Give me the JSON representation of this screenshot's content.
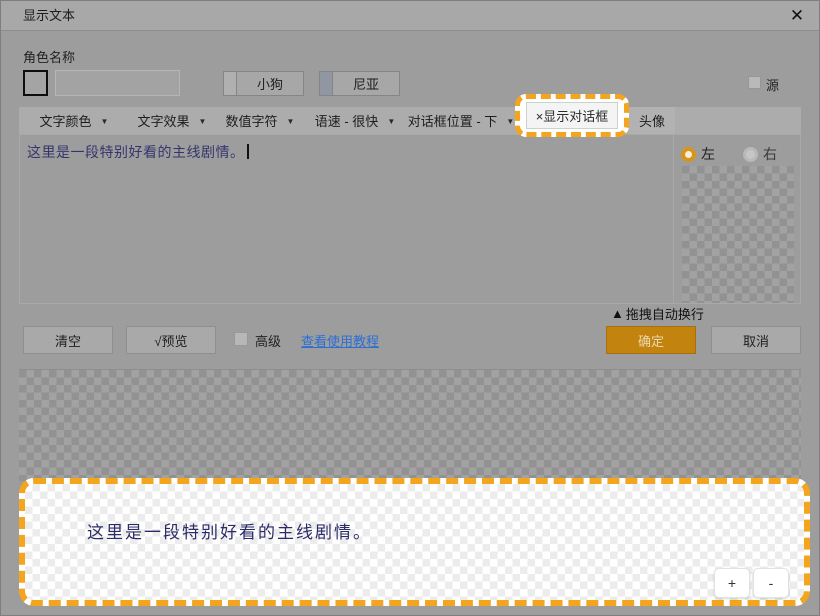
{
  "window": {
    "title": "显示文本"
  },
  "icons": {
    "close": "✕",
    "caret": "▼",
    "triangle": "▲"
  },
  "character": {
    "label": "角色名称",
    "name_input_value": "",
    "buttons": [
      {
        "label": "小狗"
      },
      {
        "label": "尼亚"
      }
    ],
    "source_label": "源"
  },
  "toolbar": {
    "dropdowns": [
      {
        "label": "文字颜色"
      },
      {
        "label": "文字效果"
      },
      {
        "label": "数值字符"
      },
      {
        "label": "语速 - 很快"
      },
      {
        "label": "对话框位置 - 下"
      }
    ],
    "show_dialog_label": "×显示对话框",
    "avatar_label": "头像"
  },
  "editor": {
    "text": "这里是一段特别好看的主线剧情。"
  },
  "panel": {
    "left_label": "左",
    "right_label": "右",
    "drag_hint": "拖拽自动换行"
  },
  "actions": {
    "clear": "清空",
    "preview": "√预览",
    "advanced": "高级",
    "tutorial": "查看使用教程",
    "ok": "确定",
    "cancel": "取消"
  },
  "preview": {
    "text": "这里是一段特别好看的主线剧情。",
    "zoom_in": "+",
    "zoom_out": "-"
  },
  "colors": {
    "accent_orange": "#F2A51D",
    "ok_button": "#C2830F",
    "link_blue": "#2A6FD4",
    "editor_text": "#35356E",
    "preview_text": "#2B2B68"
  }
}
